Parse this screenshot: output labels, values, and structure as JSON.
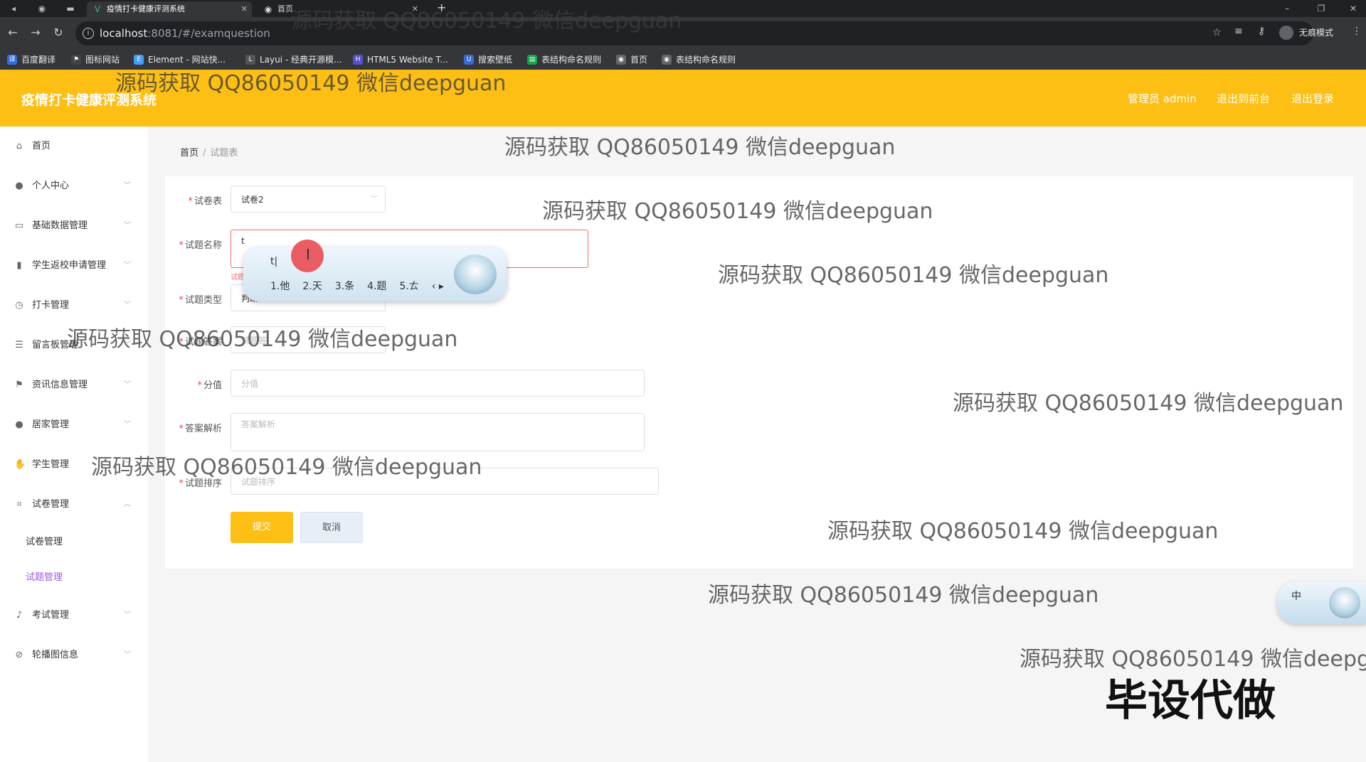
{
  "browser": {
    "tabs": [
      {
        "title": "疫情打卡健康评测系统",
        "active": true
      },
      {
        "title": "首页",
        "active": false
      }
    ],
    "url_host": "localhost",
    "url_rest": ":8081/#/examquestion",
    "profile_label": "无痕模式",
    "bookmarks": [
      "百度翻译",
      "图标网站",
      "Element - 网站快...",
      "Layui - 经典开源模...",
      "HTML5 Website T...",
      "搜索壁纸",
      "表结构命名规则",
      "首页",
      "表结构命名规则"
    ]
  },
  "header": {
    "title": "疫情打卡健康评测系统",
    "admin_label": "管理员 admin",
    "front_label": "退出到前台",
    "logout_label": "退出登录",
    "accent_color": "#fdbf14"
  },
  "sidebar": {
    "items": [
      {
        "label": "首页",
        "icon": "home-icon",
        "expandable": false
      },
      {
        "label": "个人中心",
        "icon": "user-icon",
        "expandable": true
      },
      {
        "label": "基础数据管理",
        "icon": "card-icon",
        "expandable": true
      },
      {
        "label": "学生返校申请管理",
        "icon": "bar-chart-icon",
        "expandable": true
      },
      {
        "label": "打卡管理",
        "icon": "clock-icon",
        "expandable": true
      },
      {
        "label": "留言板管理",
        "icon": "list-icon",
        "expandable": true
      },
      {
        "label": "资讯信息管理",
        "icon": "flag-icon",
        "expandable": true
      },
      {
        "label": "居家管理",
        "icon": "person-icon",
        "expandable": true
      },
      {
        "label": "学生管理",
        "icon": "thumb-icon",
        "expandable": true
      },
      {
        "label": "试卷管理",
        "icon": "crop-icon",
        "expandable": true,
        "open": true
      },
      {
        "label": "考试管理",
        "icon": "mic-icon",
        "expandable": true
      },
      {
        "label": "轮播图信息",
        "icon": "compass-icon",
        "expandable": true
      }
    ],
    "sub_items": [
      {
        "label": "试卷管理",
        "active": false
      },
      {
        "label": "试题管理",
        "active": true
      }
    ]
  },
  "breadcrumb": {
    "home": "首页",
    "current": "试题表"
  },
  "form": {
    "paper": {
      "label": "试卷表",
      "value": "试卷2"
    },
    "name": {
      "label": "试题名称",
      "value": "t",
      "error": "试题"
    },
    "type": {
      "label": "试题类型",
      "value": "判断"
    },
    "answer": {
      "label": "试题答案",
      "placeholder": "试题答"
    },
    "score": {
      "label": "分值",
      "placeholder": "分值"
    },
    "analysis": {
      "label": "答案解析",
      "placeholder": "答案解析"
    },
    "order": {
      "label": "试题排序",
      "placeholder": "试题排序"
    },
    "submit_label": "提交",
    "cancel_label": "取消"
  },
  "ime": {
    "composition": "t|",
    "candidates": [
      "1.他",
      "2.天",
      "3.条",
      "4.题",
      "5.ㄊ"
    ],
    "status_label": "中"
  },
  "watermarks": {
    "text": "源码获取 QQ86050149 微信deepguan",
    "big": "毕设代做"
  }
}
